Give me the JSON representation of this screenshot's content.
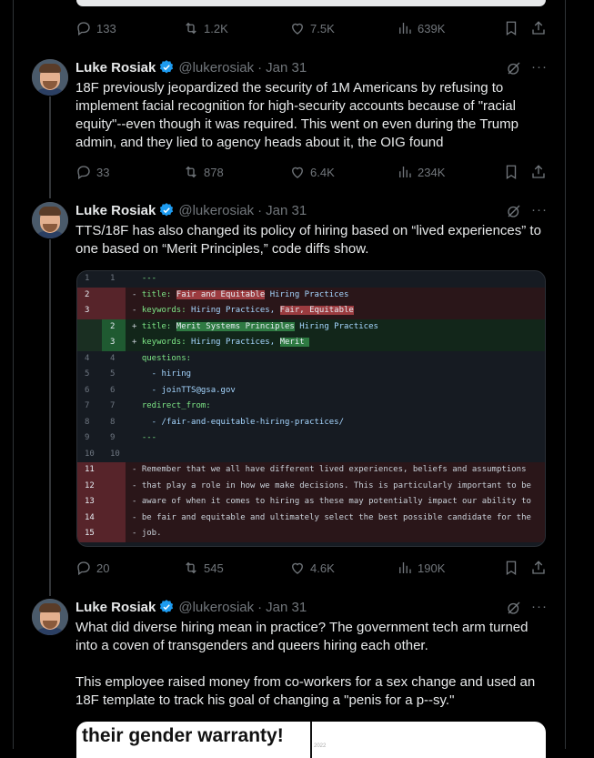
{
  "top_tweet_stats": {
    "replies": "133",
    "reposts": "1.2K",
    "likes": "7.5K",
    "views": "639K"
  },
  "tweets": [
    {
      "name": "Luke Rosiak",
      "handle": "@lukerosiak",
      "dot": "·",
      "date": "Jan 31",
      "paragraphs": [
        "18F previously jeopardized the security of 1M Americans by refusing to implement facial recognition for high-security accounts because of \"racial equity\"--even though it was required. This went on even during the Trump admin, and they lied to agency heads about it, the OIG found"
      ],
      "stats": {
        "replies": "33",
        "reposts": "878",
        "likes": "6.4K",
        "views": "234K"
      }
    },
    {
      "name": "Luke Rosiak",
      "handle": "@lukerosiak",
      "dot": "·",
      "date": "Jan 31",
      "paragraphs": [
        "TTS/18F has also changed its policy of hiring based on “lived experiences” to one based on “Merit Principles,” code diffs show."
      ],
      "stats": {
        "replies": "20",
        "reposts": "545",
        "likes": "4.6K",
        "views": "190K"
      }
    },
    {
      "name": "Luke Rosiak",
      "handle": "@lukerosiak",
      "dot": "·",
      "date": "Jan 31",
      "paragraphs": [
        "What did diverse hiring mean in practice? The government tech arm turned into a coven of transgenders and queers hiring each other.",
        "This employee raised money from co-workers for a sex change and used an 18F template to track his goal of changing a \"penis for a p--sy.\""
      ]
    }
  ],
  "diff": {
    "rows": [
      {
        "type": "ctx",
        "o": "1",
        "n": "1",
        "sign": " ",
        "parts": [
          {
            "t": "---",
            "c": "k"
          }
        ]
      },
      {
        "type": "del",
        "o": "2",
        "n": "",
        "sign": "-",
        "parts": [
          {
            "t": "title: ",
            "c": "k"
          },
          {
            "t": "Fair and Equitable",
            "c": "hl-del"
          },
          {
            "t": " Hiring Practices",
            "c": "s"
          }
        ]
      },
      {
        "type": "del",
        "o": "3",
        "n": "",
        "sign": "-",
        "parts": [
          {
            "t": "keywords: ",
            "c": "k"
          },
          {
            "t": "Hiring Practices, ",
            "c": "s"
          },
          {
            "t": "Fair, Equitable",
            "c": "hl-del"
          }
        ]
      },
      {
        "type": "add",
        "o": "",
        "n": "2",
        "sign": "+",
        "parts": [
          {
            "t": "title: ",
            "c": "k"
          },
          {
            "t": "Merit Systems Principles",
            "c": "hl-add"
          },
          {
            "t": " Hiring Practices",
            "c": "s"
          }
        ]
      },
      {
        "type": "add",
        "o": "",
        "n": "3",
        "sign": "+",
        "parts": [
          {
            "t": "keywords: ",
            "c": "k"
          },
          {
            "t": "Hiring Practices, ",
            "c": "s"
          },
          {
            "t": "Merit ",
            "c": "hl-add"
          }
        ]
      },
      {
        "type": "ctx",
        "o": "4",
        "n": "4",
        "sign": " ",
        "parts": [
          {
            "t": "questions:",
            "c": "k"
          }
        ]
      },
      {
        "type": "ctx",
        "o": "5",
        "n": "5",
        "sign": " ",
        "parts": [
          {
            "t": "  - hiring",
            "c": "s"
          }
        ]
      },
      {
        "type": "ctx",
        "o": "6",
        "n": "6",
        "sign": " ",
        "parts": [
          {
            "t": "  - joinTTS@gsa.gov",
            "c": "s"
          }
        ]
      },
      {
        "type": "ctx",
        "o": "7",
        "n": "7",
        "sign": " ",
        "parts": [
          {
            "t": "redirect_from:",
            "c": "k"
          }
        ]
      },
      {
        "type": "ctx",
        "o": "8",
        "n": "8",
        "sign": " ",
        "parts": [
          {
            "t": "  - /fair-and-equitable-hiring-practices/",
            "c": "s"
          }
        ]
      },
      {
        "type": "ctx",
        "o": "9",
        "n": "9",
        "sign": " ",
        "parts": [
          {
            "t": "---",
            "c": "k"
          }
        ]
      },
      {
        "type": "ctx",
        "o": "10",
        "n": "10",
        "sign": " ",
        "parts": [
          {
            "t": "",
            "c": "s"
          }
        ]
      },
      {
        "type": "del",
        "o": "11",
        "n": "",
        "sign": "-",
        "parts": [
          {
            "t": "Remember that we all have different lived experiences, beliefs and assumptions",
            "c": "p"
          }
        ]
      },
      {
        "type": "del",
        "o": "12",
        "n": "",
        "sign": "-",
        "parts": [
          {
            "t": "that play a role in how we make decisions. This is particularly important to be",
            "c": "p"
          }
        ]
      },
      {
        "type": "del",
        "o": "13",
        "n": "",
        "sign": "-",
        "parts": [
          {
            "t": "aware of when it comes to hiring as these may potentially impact our ability to",
            "c": "p"
          }
        ]
      },
      {
        "type": "del",
        "o": "14",
        "n": "",
        "sign": "-",
        "parts": [
          {
            "t": "be fair and equitable and ultimately select the best possible candidate for the",
            "c": "p"
          }
        ]
      },
      {
        "type": "del",
        "o": "15",
        "n": "",
        "sign": "-",
        "parts": [
          {
            "t": "job.",
            "c": "p"
          }
        ]
      }
    ]
  },
  "partial_image": {
    "heading": "their gender warranty!",
    "small": "2022"
  }
}
